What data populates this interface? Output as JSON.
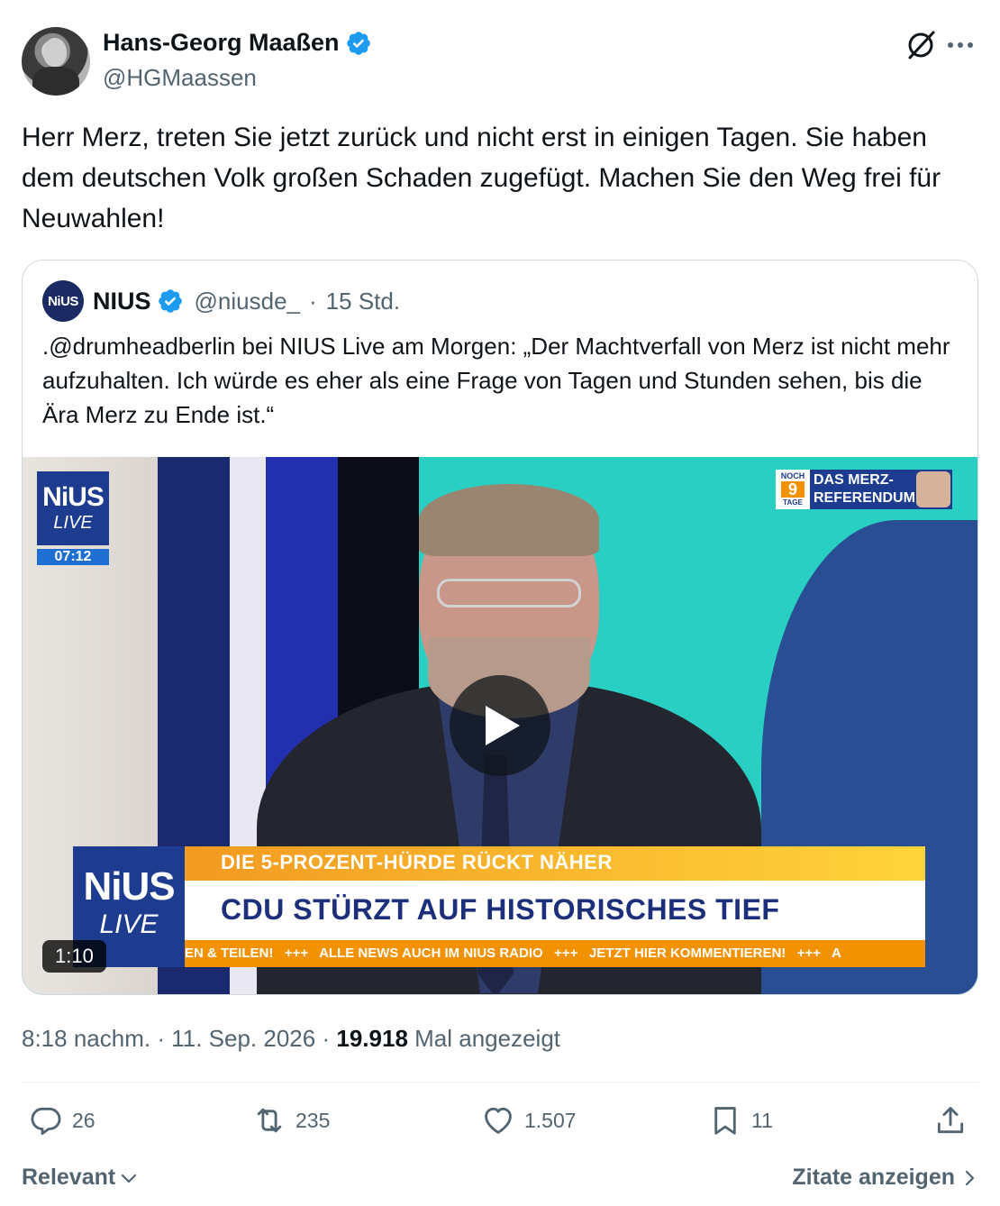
{
  "author": {
    "display_name": "Hans-Georg Maaßen",
    "handle": "@HGMaassen",
    "verified": true
  },
  "tweet": {
    "text": "Herr Merz, treten Sie jetzt zurück und nicht erst in einigen Tagen. Sie haben dem deutschen Volk großen Schaden zugefügt. Machen Sie den Weg frei für Neuwahlen!"
  },
  "quote": {
    "logo_text": "NiUS",
    "name": "NIUS",
    "handle": "@niusde_",
    "separator": "·",
    "time": "15 Std.",
    "text": ".@drumheadberlin bei NIUS Live am Morgen: „Der Machtverfall von Merz ist nicht mehr aufzuhalten. Ich würde es eher als eine Frage von Tagen und Stunden sehen, bis die Ära Merz zu Ende ist.“",
    "video": {
      "duration": "1:10",
      "badge_title": "NiUS",
      "badge_sub": "LIVE",
      "badge_time": "07:12",
      "referendum_noch": "NOCH",
      "referendum_number": "9",
      "referendum_tage": "TAGE",
      "referendum_line1": "DAS MERZ-",
      "referendum_line2": "REFERENDUM",
      "lower_logo_title": "NiUS",
      "lower_logo_sub": "LIVE",
      "headline_top": "DIE 5-PROZENT-HÜRDE RÜCKT NÄHER",
      "headline_main": "CDU STÜRZT AUF HISTORISCHES TIEF",
      "ticker": "EN & TEILEN!   +++   ALLE NEWS AUCH IM NIUS RADIO   +++   JETZT HIER KOMMENTIEREN!   +++   A"
    }
  },
  "meta": {
    "time": "8:18 nachm.",
    "sep1": "·",
    "date": "11. Sep. 2026",
    "sep2": "·",
    "views_count": "19.918",
    "views_label": "Mal angezeigt"
  },
  "actions": {
    "replies": "26",
    "reposts": "235",
    "likes": "1.507",
    "bookmarks": "11"
  },
  "footer": {
    "sort_label": "Relevant",
    "quotes_label": "Zitate anzeigen"
  },
  "colors": {
    "verified_blue": "#1d9bf0",
    "secondary_text": "#536471",
    "nius_navy": "#1d3b8f",
    "nius_orange": "#f39200"
  },
  "icons": {
    "verified": "verified-badge-icon",
    "grok": "grok-icon",
    "more": "more-icon",
    "reply": "reply-icon",
    "repost": "repost-icon",
    "like": "heart-icon",
    "bookmark": "bookmark-icon",
    "share": "share-icon",
    "play": "play-icon"
  }
}
